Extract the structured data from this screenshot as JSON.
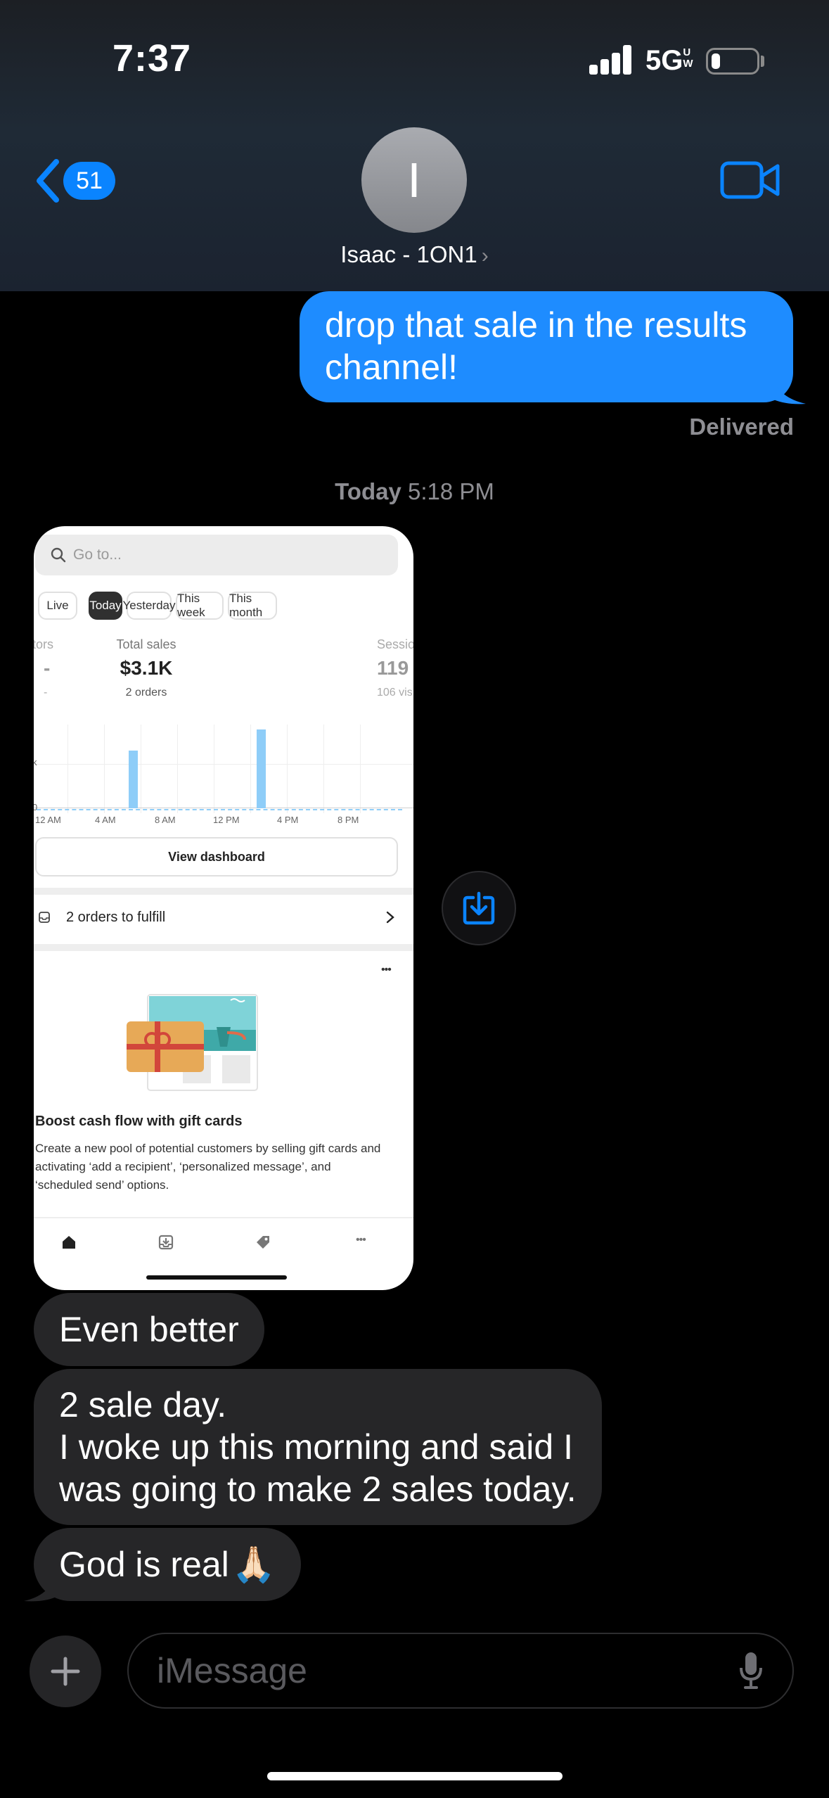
{
  "status_bar": {
    "time": "7:37",
    "network": "5G",
    "network_badge": "UW"
  },
  "header": {
    "unread_count": "51",
    "avatar_initial": "I",
    "contact_name": "Isaac - 1ON1",
    "contact_chevron": "›"
  },
  "messages": {
    "outgoing_1": "drop that sale in the results channel!",
    "delivered": "Delivered",
    "timestamp_day": "Today",
    "timestamp_time": "5:18 PM",
    "incoming_1": "Even better",
    "incoming_2_line1": "2 sale day.",
    "incoming_2_line2": "I woke up this morning and said I",
    "incoming_2_line3": "was going to make 2 sales today.",
    "incoming_3": "God is real",
    "incoming_3_emoji": "🙏🏻"
  },
  "shared_screenshot": {
    "search_placeholder": "Go to...",
    "chips": [
      "Live",
      "Today",
      "Yesterday",
      "This week",
      "This month"
    ],
    "active_chip": "Today",
    "left_metric": {
      "label": "tors",
      "value": "-",
      "sub": "-"
    },
    "total_sales": {
      "label": "Total sales",
      "value": "$3.1K",
      "sub": "2 orders"
    },
    "right_metric": {
      "label": "Sessio",
      "value": "119",
      "sub": "106 vis"
    },
    "y_ticks": [
      "k",
      "0"
    ],
    "x_ticks": [
      "12 AM",
      "4 AM",
      "8 AM",
      "12 PM",
      "4 PM",
      "8 PM"
    ],
    "view_dashboard": "View dashboard",
    "orders_to_fulfill": "2 orders to fulfill",
    "more_menu": "•••",
    "boost_title": "Boost cash flow with gift cards",
    "boost_desc": "Create a new pool of potential customers by selling gift cards and activating ‘add a recipient’, ‘personalized message’, and ‘scheduled send’ options.",
    "nav_more": "•••"
  },
  "input": {
    "placeholder": "iMessage"
  },
  "colors": {
    "accent": "#0a84ff",
    "outgoing_bubble": "#1e8cff",
    "incoming_bubble": "#262628",
    "chart_bar": "#8ecdf8"
  },
  "chart_data": {
    "type": "bar",
    "title": "",
    "x_ticks": [
      "12 AM",
      "4 AM",
      "8 AM",
      "12 PM",
      "4 PM",
      "8 PM"
    ],
    "spike_bars": [
      {
        "slot": 9,
        "height_fraction": 0.73
      },
      {
        "slot": 23,
        "height_fraction": 1.0
      }
    ]
  }
}
